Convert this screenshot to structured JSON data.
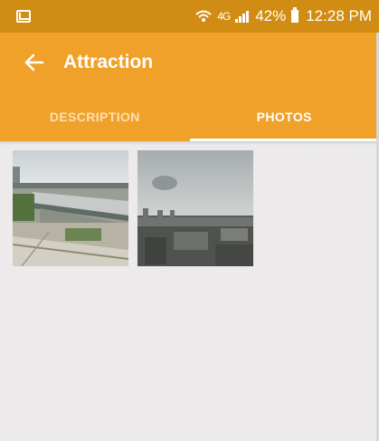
{
  "status_bar": {
    "signal": "4G",
    "battery": "42%",
    "time": "12:28 PM"
  },
  "app_bar": {
    "title": "Attraction",
    "back_icon": "arrow-left-icon"
  },
  "tabs": [
    {
      "label": "DESCRIPTION",
      "active": false
    },
    {
      "label": "PHOTOS",
      "active": true
    }
  ],
  "photos": [
    {
      "description_icon": "photo-campus-aerial"
    },
    {
      "description_icon": "photo-city-skyline"
    }
  ],
  "colors": {
    "status_bar": "#d18c13",
    "app_bar": "#f0a12a",
    "background": "#eceaea"
  }
}
